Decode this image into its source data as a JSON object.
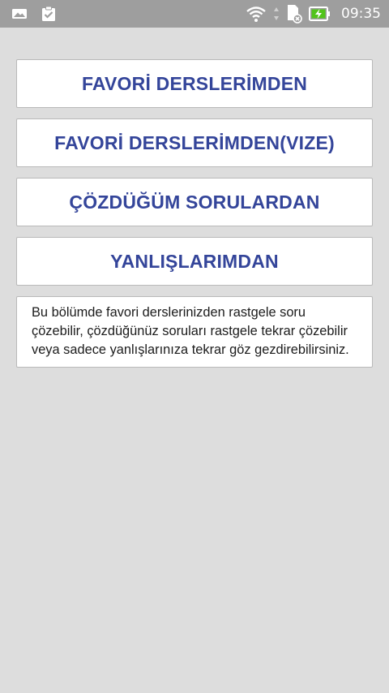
{
  "status_bar": {
    "time": "09:35",
    "left_icons": [
      "image-icon",
      "clipboard-check-icon"
    ],
    "right_icons": [
      "wifi-icon",
      "sim-card-icon",
      "battery-charging-icon"
    ],
    "color_bg": "#9e9e9e"
  },
  "menu": {
    "buttons": [
      {
        "label": "FAVORİ DERSLERİMDEN"
      },
      {
        "label": "FAVORİ DERSLERİMDEN(VIZE)"
      },
      {
        "label": "ÇÖZDÜĞÜM SORULARDAN"
      },
      {
        "label": "YANLIŞLARIMDAN"
      }
    ],
    "accent_color": "#34459a"
  },
  "info": {
    "text": "Bu bölümde favori derslerinizden rastgele soru çözebilir, çözdüğünüz soruları rastgele tekrar çözebilir veya sadece yanlışlarınıza tekrar göz gezdirebilirsiniz."
  }
}
